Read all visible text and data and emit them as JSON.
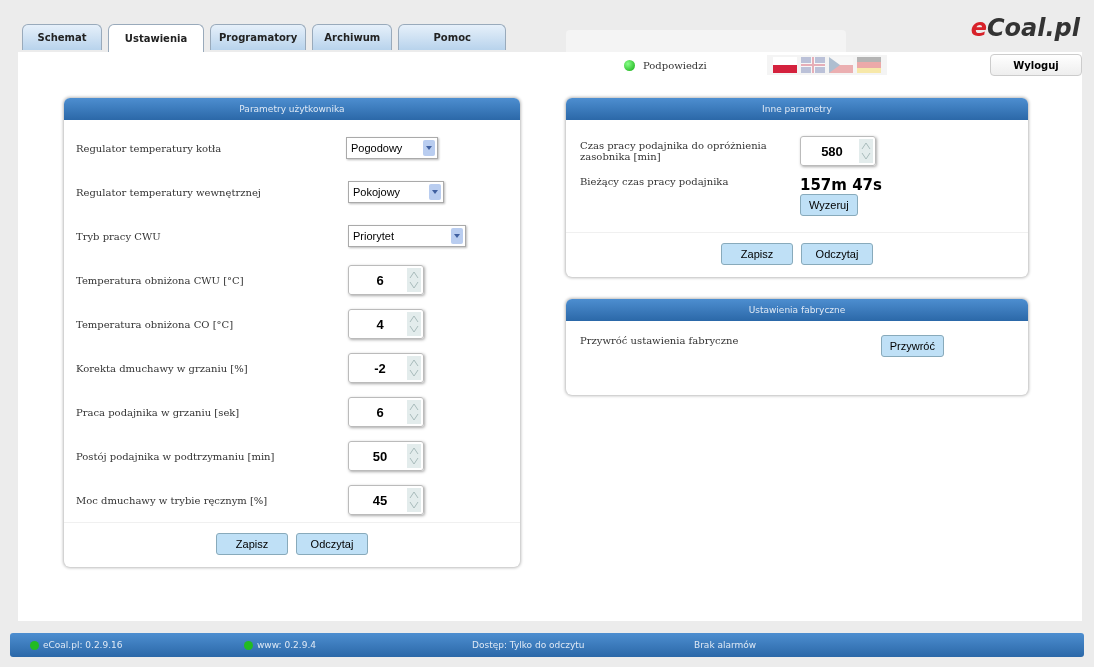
{
  "tabs": [
    {
      "label": "Schemat",
      "selected": false
    },
    {
      "label": "Ustawienia",
      "selected": true
    },
    {
      "label": "Programatory",
      "selected": false
    },
    {
      "label": "Archiwum",
      "selected": false
    },
    {
      "label": "Pomoc",
      "selected": false
    }
  ],
  "logo": "eCoal.pl",
  "hints": {
    "label": "Podpowiedzi",
    "on": true
  },
  "flags": [
    {
      "selected": true
    },
    {
      "selected": false
    },
    {
      "selected": false
    },
    {
      "selected": false
    }
  ],
  "logout": "Wyloguj",
  "user_panel": {
    "title": "Parametry użytkownika",
    "fields": [
      {
        "kind": "select",
        "label": "Regulator temperatury kotła",
        "value": "Pogodowy"
      },
      {
        "kind": "select",
        "label": "Regulator temperatury wewnętrznej",
        "value": "Pokojowy"
      },
      {
        "kind": "select",
        "label": "Tryb pracy CWU",
        "value": "Priorytet"
      },
      {
        "kind": "spinner",
        "label": "Temperatura obniżona CWU [°C]",
        "value": "6"
      },
      {
        "kind": "spinner",
        "label": "Temperatura obniżona CO [°C]",
        "value": "4"
      },
      {
        "kind": "spinner",
        "label": "Korekta dmuchawy w grzaniu [%]",
        "value": "-2"
      },
      {
        "kind": "spinner",
        "label": "Praca podajnika w grzaniu [sek]",
        "value": "6"
      },
      {
        "kind": "spinner",
        "label": "Postój podajnika w podtrzymaniu [min]",
        "value": "50"
      },
      {
        "kind": "spinner",
        "label": "Moc dmuchawy w trybie ręcznym [%]",
        "value": "45"
      }
    ],
    "buttons": [
      "Zapisz",
      "Odczytaj"
    ]
  },
  "other_panel": {
    "title": "Inne parametry",
    "fields": [
      {
        "kind": "spinner",
        "label": "Czas pracy podajnika do opróżnienia zasobnika [min]",
        "value": "580"
      },
      {
        "kind": "reading",
        "label": "Bieżący czas pracy podajnika",
        "value": "157m 47s",
        "button": "Wyzeruj"
      }
    ],
    "buttons": [
      "Zapisz",
      "Odczytaj"
    ]
  },
  "factory_panel": {
    "title": "Ustawienia fabryczne",
    "label": "Przywróć ustawienia fabryczne",
    "button": "Przywróć"
  },
  "status_bar": [
    {
      "text": "eCoal.pl: 0.2.9.16",
      "color": "#22bb22"
    },
    {
      "text": "www: 0.2.9.4",
      "color": "#22bb22"
    },
    {
      "text": "Dostęp: Tylko do odczytu"
    },
    {
      "text": "Brak alarmów"
    }
  ]
}
